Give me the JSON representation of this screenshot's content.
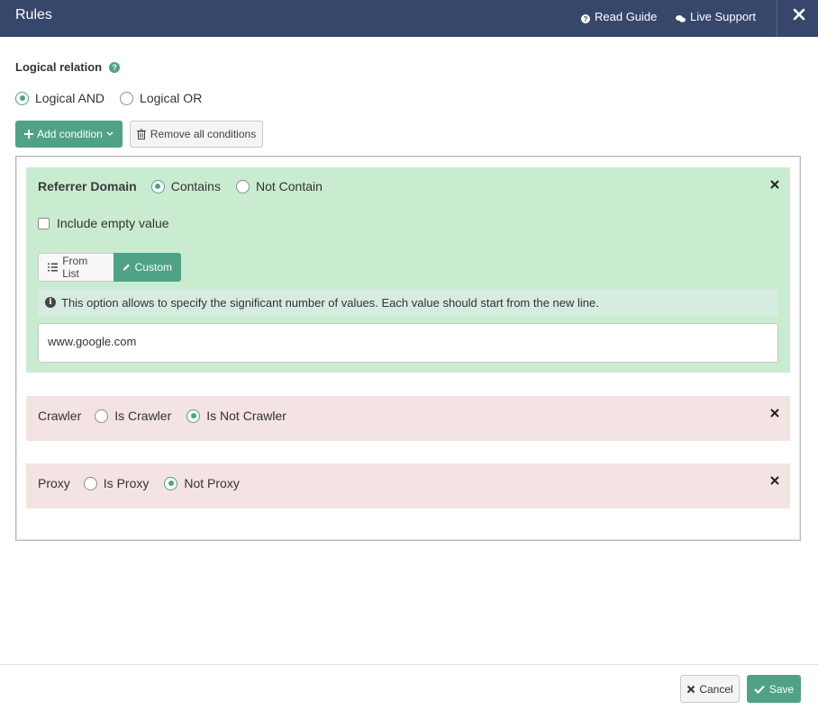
{
  "header": {
    "title": "Rules",
    "read_guide": "Read Guide",
    "live_support": "Live Support"
  },
  "logic": {
    "label": "Logical relation",
    "options": [
      {
        "label": "Logical AND",
        "selected": true
      },
      {
        "label": "Logical OR",
        "selected": false
      }
    ]
  },
  "toolbar": {
    "add_label": "Add condition",
    "remove_label": "Remove all conditions"
  },
  "conditions": [
    {
      "label": "Referrer Domain",
      "options": [
        {
          "label": "Contains",
          "selected": true
        },
        {
          "label": "Not Contain",
          "selected": false
        }
      ],
      "include_empty_label": "Include empty value",
      "include_empty_checked": false,
      "mode_from_list": "From List",
      "mode_custom": "Custom",
      "info": "This option allows to specify the significant number of values. Each value should start from the new line.",
      "value": "www.google.com"
    },
    {
      "label": "Crawler",
      "options": [
        {
          "label": "Is Crawler",
          "selected": false
        },
        {
          "label": "Is Not Crawler",
          "selected": true
        }
      ]
    },
    {
      "label": "Proxy",
      "options": [
        {
          "label": "Is Proxy",
          "selected": false
        },
        {
          "label": "Not Proxy",
          "selected": true
        }
      ]
    }
  ],
  "footer": {
    "cancel_label": "Cancel",
    "save_label": "Save"
  },
  "colors": {
    "header_bg": "#36476b",
    "accent": "#4fa286",
    "condition_green": "#c9ebcf",
    "condition_pink": "#f3e3e2"
  }
}
